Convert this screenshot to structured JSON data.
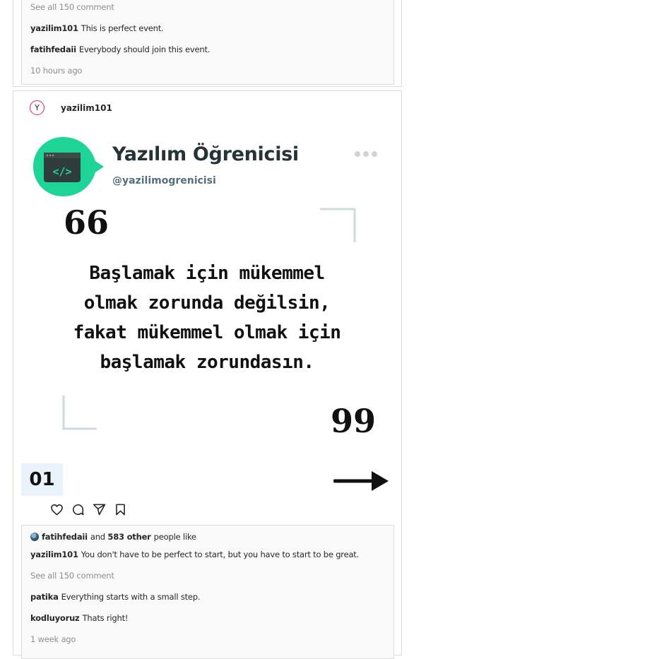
{
  "post1": {
    "see_all": "See all 150 comment",
    "comments": [
      {
        "user": "yazilim101",
        "text": "This is perfect event."
      },
      {
        "user": "fatihfedaii",
        "text": "Everybody should join this event."
      }
    ],
    "time": "10 hours ago"
  },
  "post2": {
    "avatar_letter": "Y",
    "username": "yazilim101",
    "image": {
      "brand_name": "Yazılım Öğrenicisi",
      "handle": "@yazilimogrenicisi",
      "code_symbol": "</>",
      "quote_lines": [
        "Başlamak için mükemmel",
        "olmak zorunda değilsin,",
        "fakat mükemmel olmak için",
        "başlamak zorundasın."
      ],
      "open_quote": "66",
      "close_quote": "99",
      "page_number": "01",
      "badge_color": "#1fd497"
    },
    "actions": {
      "like": "heart-icon",
      "comment": "comment-icon",
      "share": "send-icon",
      "save": "bookmark-icon"
    },
    "likes": {
      "liker": "fatihfedaii",
      "and": "and",
      "others": "583 other",
      "suffix": "people like"
    },
    "caption": {
      "user": "yazilim101",
      "text": "You don't have to be perfect to start, but you have to start to be great."
    },
    "see_all": "See all 150 comment",
    "comments": [
      {
        "user": "patika",
        "text": "Everything starts with a small step."
      },
      {
        "user": "kodluyoruz",
        "text": "Thats right!"
      }
    ],
    "time": "1 week ago"
  }
}
